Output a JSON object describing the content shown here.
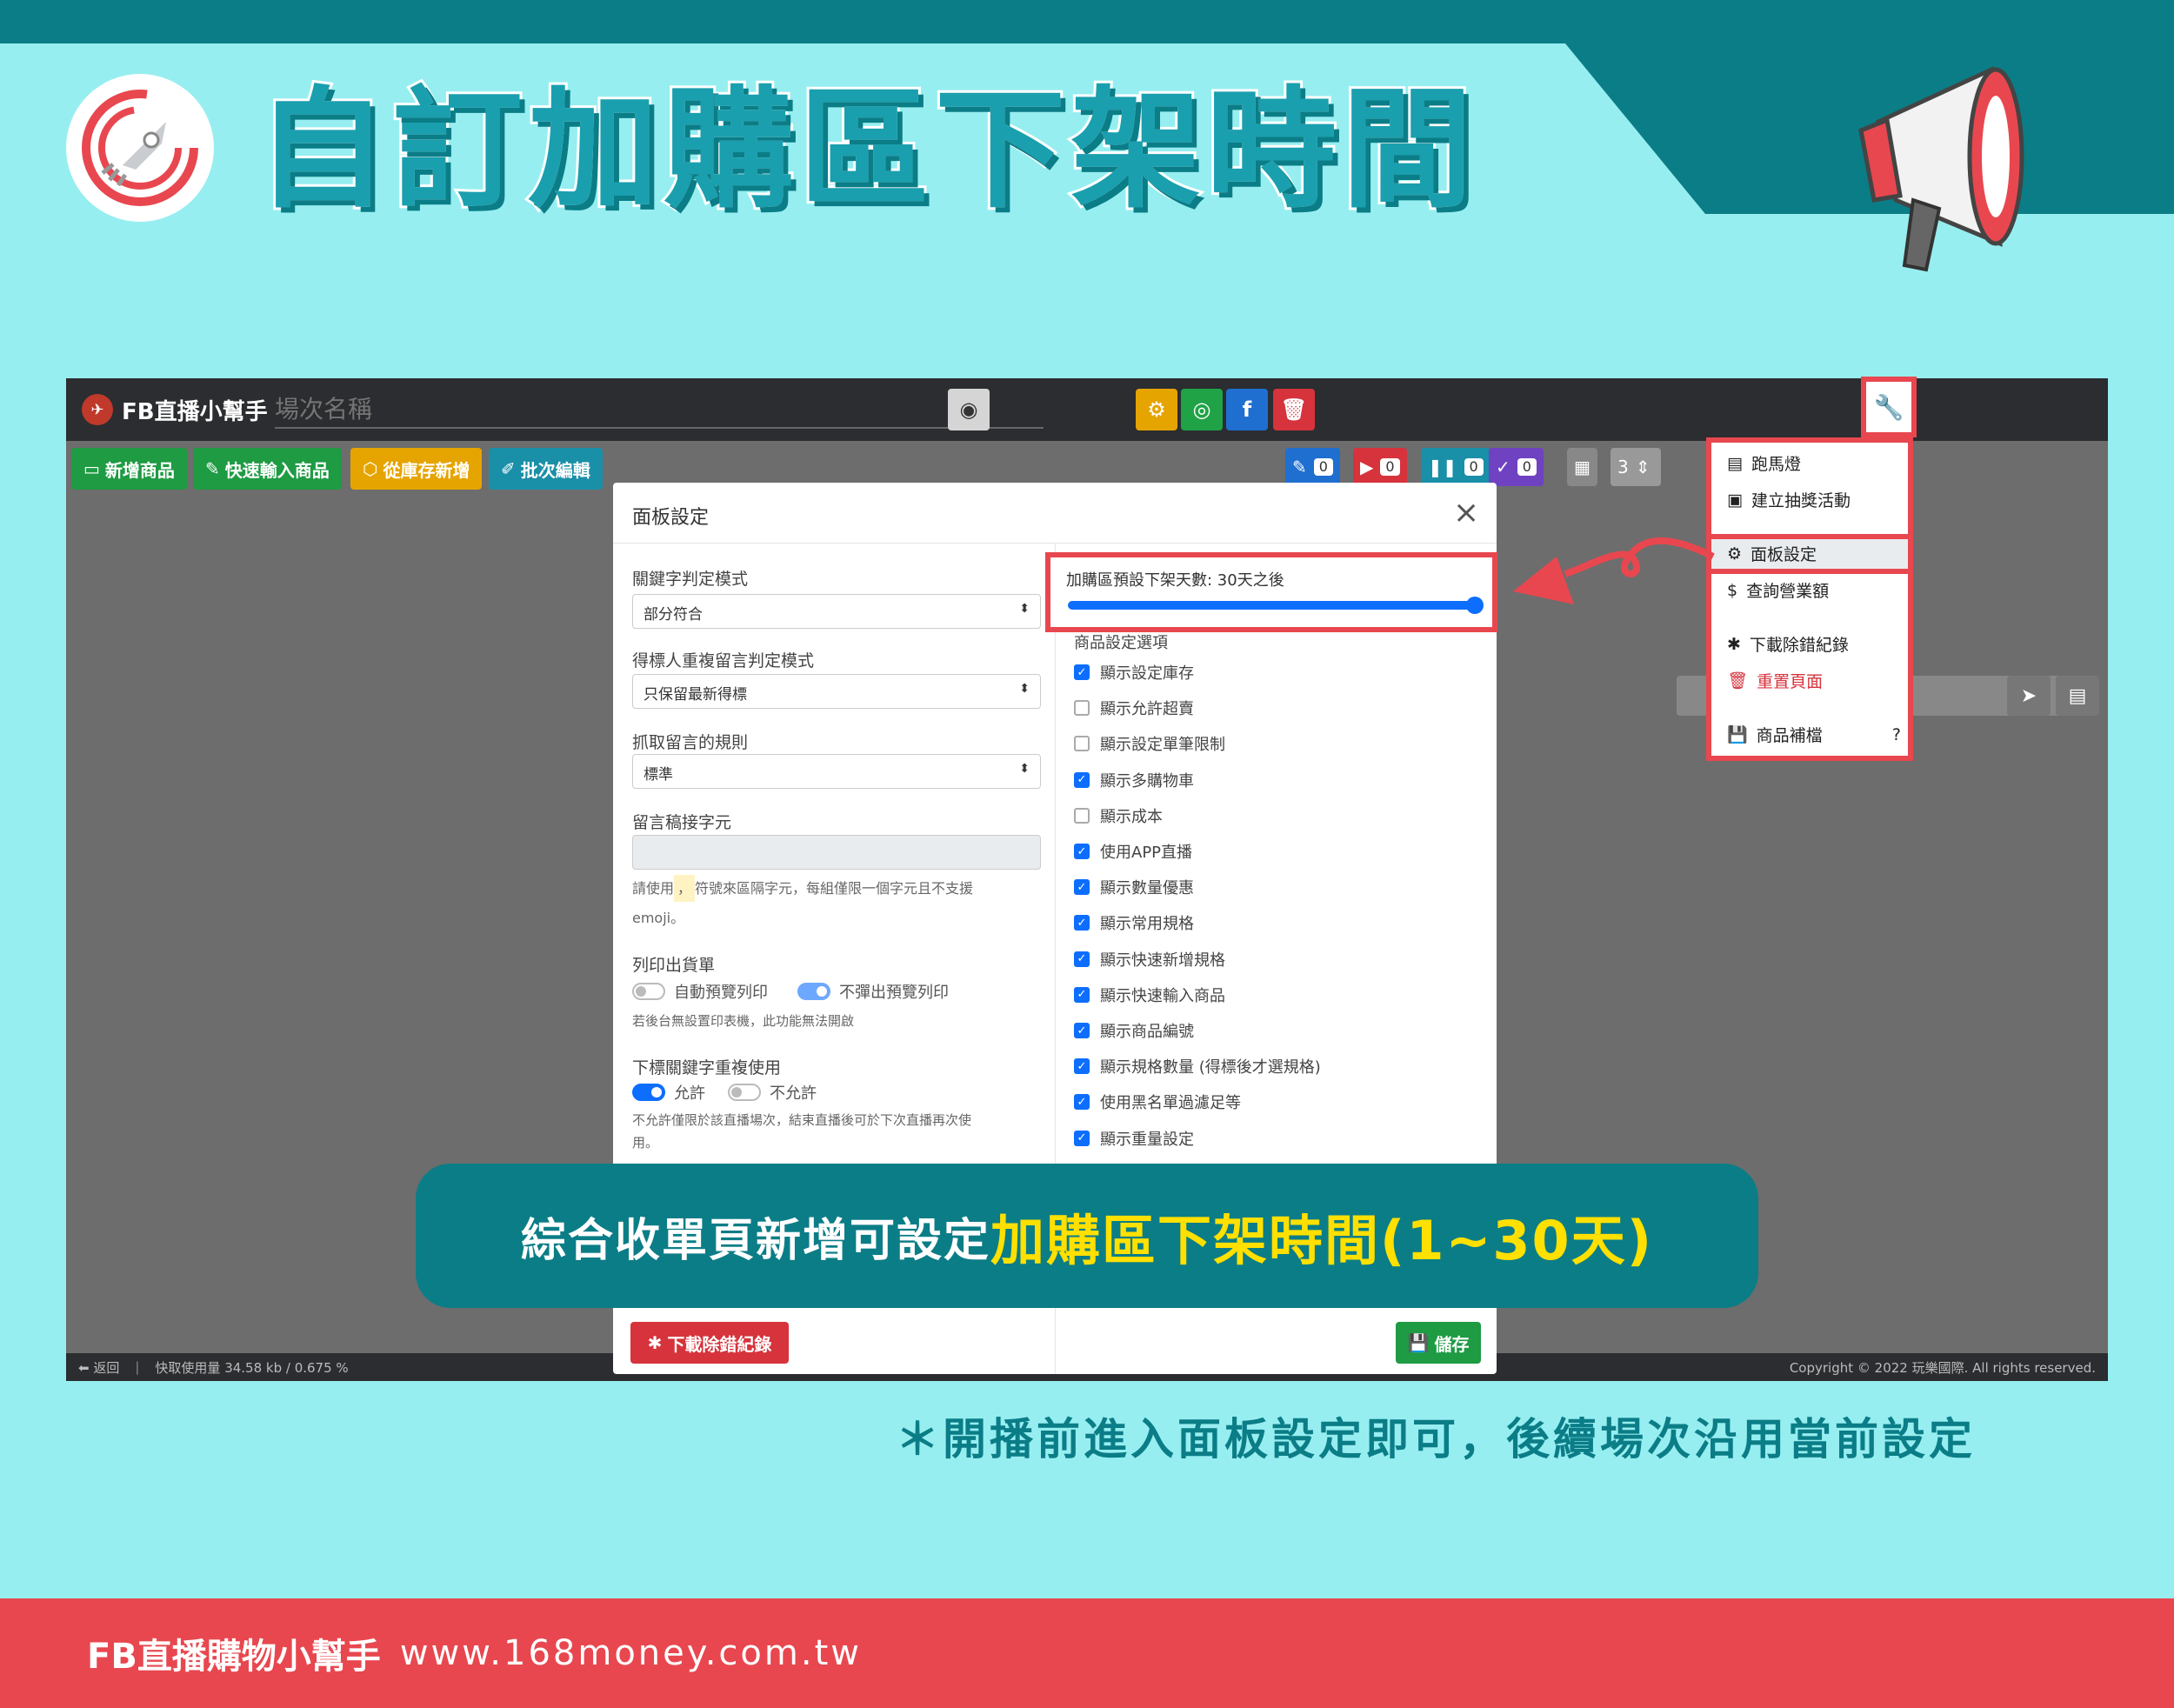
{
  "header": {
    "title": "自訂加購區下架時間"
  },
  "app": {
    "brand": "FB直播小幫手",
    "session_placeholder": "場次名稱",
    "toolbar": [
      "新增商品",
      "快速輸入商品",
      "從庫存新增",
      "批次編輯"
    ],
    "counters": [
      "0",
      "0",
      "0",
      "0"
    ],
    "grid_value": "3",
    "footer_left": "返回",
    "footer_usage": "快取使用量 34.58 kb / 0.675 %",
    "footer_copyright": "Copyright © 2022 玩樂國際. All rights reserved."
  },
  "modal": {
    "title": "面板設定",
    "close": "×",
    "left": {
      "keyword_mode_label": "關鍵字判定模式",
      "keyword_mode_value": "部分符合",
      "dup_mode_label": "得標人重複留言判定模式",
      "dup_mode_value": "只保留最新得標",
      "rule_label": "抓取留言的規則",
      "rule_value": "標準",
      "sep_label": "留言稿接字元",
      "sep_hint_1": "請使用",
      "sep_hint_mark": "，",
      "sep_hint_2": "符號來區隔字元，每組僅限一個字元且不支援",
      "sep_hint_3": "emoji。",
      "print_label": "列印出貨單",
      "print_opt1": "自動預覽列印",
      "print_opt2": "不彈出預覽列印",
      "print_hint": "若後台無設置印表機，此功能無法開啟",
      "reuse_label": "下標關鍵字重複使用",
      "reuse_opt1": "允許",
      "reuse_opt2": "不允許",
      "reuse_hint_1": "不允許僅限於該直播場次，結束直播後可於下次直播再次使",
      "reuse_hint_2": "用。"
    },
    "slider": {
      "label": "加購區預設下架天數: 30天之後",
      "value_days": 30,
      "max_days": 30
    },
    "options_title": "商品設定選項",
    "options": [
      {
        "label": "顯示設定庫存",
        "checked": true
      },
      {
        "label": "顯示允許超賣",
        "checked": false
      },
      {
        "label": "顯示設定單筆限制",
        "checked": false
      },
      {
        "label": "顯示多購物車",
        "checked": true
      },
      {
        "label": "顯示成本",
        "checked": false
      },
      {
        "label": "使用APP直播",
        "checked": true
      },
      {
        "label": "顯示數量優惠",
        "checked": true
      },
      {
        "label": "顯示常用規格",
        "checked": true
      },
      {
        "label": "顯示快速新增規格",
        "checked": true
      },
      {
        "label": "顯示快速輸入商品",
        "checked": true
      },
      {
        "label": "顯示商品編號",
        "checked": true
      },
      {
        "label": "顯示規格數量 (得標後才選規格)",
        "checked": true
      },
      {
        "label": "使用黑名單過濾足等",
        "checked": true
      },
      {
        "label": "顯示重量設定",
        "checked": true
      }
    ],
    "download_btn": "下載除錯紀錄",
    "save_btn": "儲存"
  },
  "dropdown": {
    "items": [
      "跑馬燈",
      "建立抽獎活動",
      "面板設定",
      "查詢營業額",
      "下載除錯紀錄",
      "重置頁面",
      "商品補檔"
    ]
  },
  "banner": {
    "white": "綜合收單頁新增可設定",
    "yellow": "加購區下架時間(1~30天)"
  },
  "note": "＊開播前進入面板設定即可，後續場次沿用當前設定",
  "footer": {
    "brand": "FB直播購物小幫手",
    "url": "www.168money.com.tw"
  },
  "colors": {
    "teal": "#0b7d87",
    "bg": "#97eef0",
    "red": "#e8474f",
    "yellow": "#ffe000",
    "blue": "#0d6efd"
  }
}
